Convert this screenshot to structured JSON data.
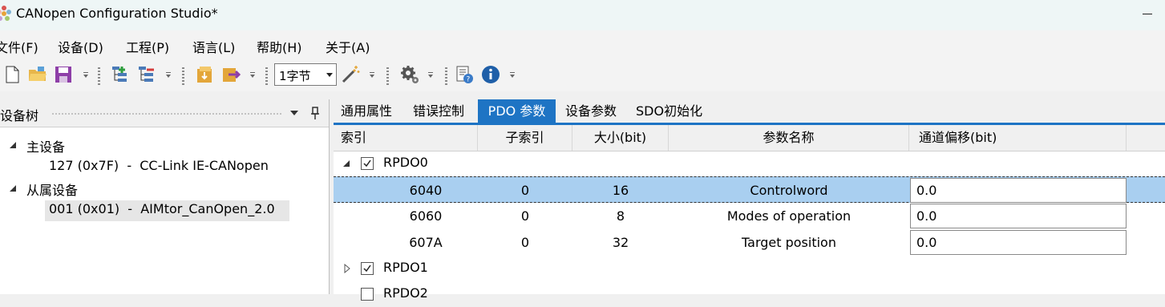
{
  "window": {
    "title": "CANopen Configuration Studio*"
  },
  "menu": [
    "文件(F)",
    "设备(D)",
    "工程(P)",
    "语言(L)",
    "帮助(H)",
    "关于(A)"
  ],
  "toolbar": {
    "icons": [
      "new-file-icon",
      "open-folder-icon",
      "save-icon",
      "add-node-icon",
      "remove-node-icon",
      "import-icon",
      "export-icon",
      "magic-wand-icon",
      "settings-gear-icon",
      "help-index-icon",
      "info-icon"
    ],
    "size_select": "1字节"
  },
  "device_tree": {
    "title": "设备树",
    "groups": [
      {
        "label": "主设备",
        "items": [
          "127 (0x7F)  -  CC-Link IE-CANopen"
        ]
      },
      {
        "label": "从属设备",
        "items": [
          "001 (0x01)  -  AIMtor_CanOpen_2.0"
        ]
      }
    ]
  },
  "tabs": [
    "通用属性",
    "错误控制",
    "PDO 参数",
    "设备参数",
    "SDO初始化"
  ],
  "active_tab": "PDO 参数",
  "grid": {
    "columns": [
      "索引",
      "子索引",
      "大小(bit)",
      "参数名称",
      "通道偏移(bit)"
    ],
    "groups": [
      {
        "name": "RPDO0",
        "checked": true,
        "expanded": true,
        "rows": [
          {
            "index": "6040",
            "sub": "0",
            "size": "16",
            "name": "Controlword",
            "offset": "0.0",
            "selected": true
          },
          {
            "index": "6060",
            "sub": "0",
            "size": "8",
            "name": "Modes of operation",
            "offset": "0.0"
          },
          {
            "index": "607A",
            "sub": "0",
            "size": "32",
            "name": "Target position",
            "offset": "0.0"
          }
        ]
      },
      {
        "name": "RPDO1",
        "checked": true,
        "expanded": false
      },
      {
        "name": "RPDO2",
        "checked": false,
        "expanded": false
      }
    ]
  }
}
